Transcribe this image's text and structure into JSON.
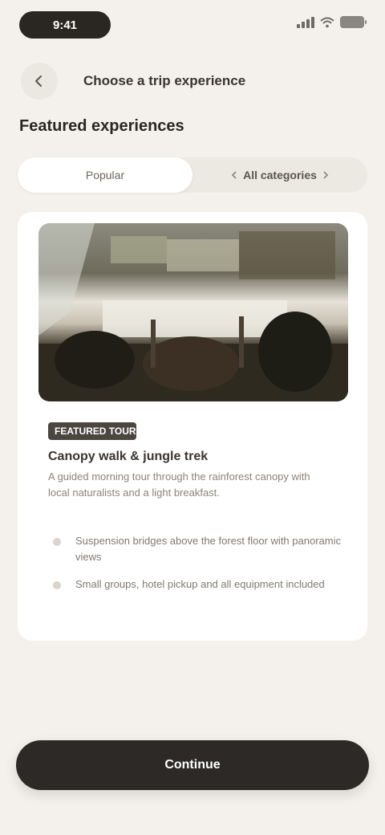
{
  "status_bar": {
    "time": "9:41"
  },
  "header": {
    "title": "Choose a trip experience",
    "back_icon": "arrow-left-icon"
  },
  "section": {
    "title": "Featured experiences"
  },
  "tabs": [
    {
      "label": "Popular",
      "active": true
    },
    {
      "label": "All categories",
      "active": false
    }
  ],
  "card": {
    "kicker": "FEATURED TOUR",
    "heading": "Canopy walk & jungle trek",
    "description": "A guided morning tour through the rainforest canopy with local naturalists and a light breakfast.",
    "bullets": [
      "Suspension bridges above the forest floor with panoramic views",
      "Small groups, hotel pickup and all equipment included"
    ]
  },
  "cta": {
    "label": "Continue"
  },
  "colors": {
    "background": "#f4f1ec",
    "primary": "#2c2926",
    "card": "#ffffff"
  }
}
